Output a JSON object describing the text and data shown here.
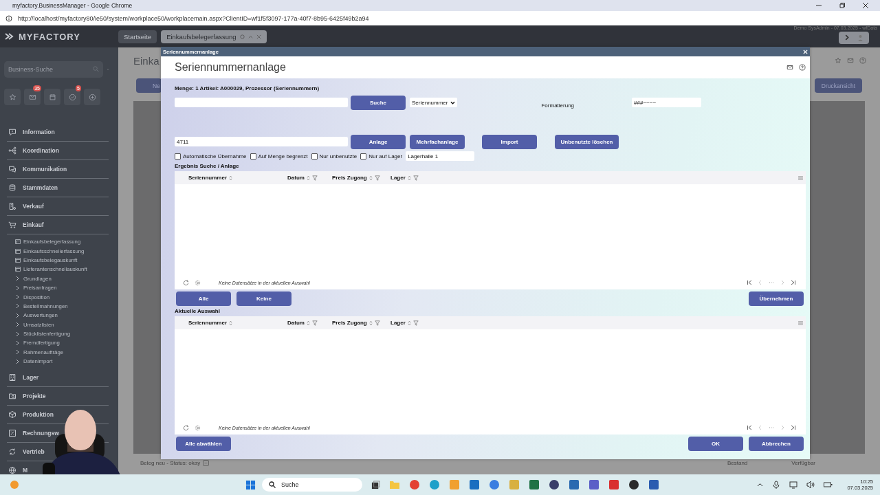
{
  "browser": {
    "title": "myfactory.BusinessManager - Google Chrome",
    "url": "http://localhost/myfactory80/ie50/system/workplace50/workplacemain.aspx?ClientID=wf1f5f3097-177a-40f7-8b95-6425f49b2a94"
  },
  "app_header": {
    "logo": "MYFACTORY",
    "user_info": "Demo SysAdmin - 07.03.2025 - wfData",
    "tabs": [
      {
        "label": "Startseite",
        "selected": false
      },
      {
        "label": "Einkaufsbelegerfassung",
        "selected": true
      }
    ]
  },
  "sidebar": {
    "search": {
      "placeholder": "Business-Suche"
    },
    "quick_buttons": [
      {
        "kind": "star"
      },
      {
        "kind": "mail",
        "badge": "35"
      },
      {
        "kind": "calendar"
      },
      {
        "kind": "check",
        "badge": "5"
      },
      {
        "kind": "plus"
      }
    ],
    "sections": [
      {
        "label": "Information",
        "kind": "info"
      },
      {
        "label": "Koordination",
        "kind": "nodes"
      },
      {
        "label": "Kommunikation",
        "kind": "chat"
      },
      {
        "label": "Stammdaten",
        "kind": "database"
      },
      {
        "label": "Verkauf",
        "kind": "sales"
      },
      {
        "label": "Einkauf",
        "kind": "cart",
        "children": [
          {
            "label": "Einkaufsbelegerfassung",
            "kind": "page"
          },
          {
            "label": "Einkaufsschnellerfassung",
            "kind": "page"
          },
          {
            "label": "Einkaufsbelegauskunft",
            "kind": "page"
          },
          {
            "label": "Lieferantenschnellauskunft",
            "kind": "page"
          },
          {
            "label": "Grundlagen",
            "kind": "folder"
          },
          {
            "label": "Preisanfragen",
            "kind": "folder"
          },
          {
            "label": "Disposition",
            "kind": "folder"
          },
          {
            "label": "Bestellmahnungen",
            "kind": "folder"
          },
          {
            "label": "Auswertungen",
            "kind": "folder"
          },
          {
            "label": "Umsatzlisten",
            "kind": "folder"
          },
          {
            "label": "Stücklistenfertigung",
            "kind": "folder"
          },
          {
            "label": "Fremdfertigung",
            "kind": "folder"
          },
          {
            "label": "Rahmenaufträge",
            "kind": "folder"
          },
          {
            "label": "Datenimport",
            "kind": "folder"
          }
        ]
      },
      {
        "label": "Lager",
        "kind": "warehouse"
      },
      {
        "label": "Projekte",
        "kind": "project"
      },
      {
        "label": "Produktion",
        "kind": "box"
      },
      {
        "label": "Rechnungsw",
        "kind": "percent"
      },
      {
        "label": "Vertrieb",
        "kind": "cycle"
      },
      {
        "label": "M",
        "kind": "globe"
      }
    ]
  },
  "page": {
    "title": "Einka",
    "new_button": "Ne",
    "print_button": "Druckansicht",
    "status": "Beleg neu - Status: okay",
    "footer_labels": [
      "Bestand",
      "Verfügbar"
    ]
  },
  "dialog": {
    "title_bar": "Seriennummernanlage",
    "heading": "Seriennummernanlage",
    "info": "Menge: 1 Artikel: A000029, Prozessor (Seriennummern)",
    "search_button": "Suche",
    "search_mode": "Seriennummer",
    "format_label": "Formatierung",
    "format_value": "###~~~~",
    "serial_value": "4711",
    "actions": [
      "Anlage",
      "Mehrfachanlage",
      "Import",
      "Unbenutzte löschen"
    ],
    "options": [
      {
        "label": "Automatische Übernahme",
        "checked": false
      },
      {
        "label": "Auf Menge begrenzt",
        "checked": false
      },
      {
        "label": "Nur unbenutzte",
        "checked": false
      },
      {
        "label": "Nur auf Lager",
        "checked": false
      }
    ],
    "warehouse": "Lagerhalle 1",
    "tables": [
      {
        "title": "Ergebnis Suche / Anlage",
        "columns": [
          {
            "label": "Seriennummer",
            "filter": false
          },
          {
            "label": "Datum",
            "filter": true
          },
          {
            "label": "Preis Zugang",
            "filter": true
          },
          {
            "label": "Lager",
            "filter": true
          }
        ],
        "empty_message": "Keine Datensätze in der aktuellen Auswahl",
        "left_buttons": [
          "Alle",
          "Keine"
        ],
        "right_buttons": [
          "Übernehmen"
        ]
      },
      {
        "title": "Aktuelle Auswahl",
        "columns": [
          {
            "label": "Seriennummer",
            "filter": false
          },
          {
            "label": "Datum",
            "filter": true
          },
          {
            "label": "Preis Zugang",
            "filter": true
          },
          {
            "label": "Lager",
            "filter": true
          }
        ],
        "empty_message": "Keine Datensätze in der aktuellen Auswahl",
        "left_buttons": [
          "Alle abwählen"
        ],
        "right_buttons": [
          "OK",
          "Abbrechen"
        ]
      }
    ]
  },
  "taskbar": {
    "search_placeholder": "Suche",
    "time": "10:25",
    "date": "07.03.2025"
  }
}
